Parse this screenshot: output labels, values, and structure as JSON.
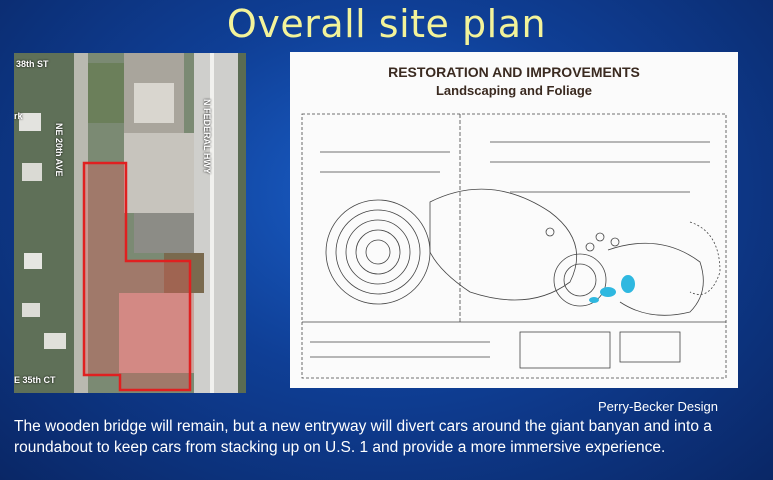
{
  "slide": {
    "title": "Overall site plan",
    "caption": "The wooden bridge will remain, but a new entryway will divert cars around the giant banyan and into a roundabout to keep cars from stacking up on U.S. 1 and provide a more immersive experience.",
    "credit": "Perry-Becker Design"
  },
  "aerial": {
    "street_38th": "38th ST",
    "street_20th": "NE 20th AVE",
    "street_federal": "N FEDERAL HWY",
    "street_35th": "E 35th CT",
    "park_fragment": "rk"
  },
  "plan": {
    "heading": "RESTORATION AND IMPROVEMENTS",
    "subheading": "Landscaping and Foliage"
  },
  "colors": {
    "title_text": "#f3f39a",
    "background": "#1a5fc9",
    "site_outline": "#e02020",
    "water_feature": "#2fb8e0"
  }
}
